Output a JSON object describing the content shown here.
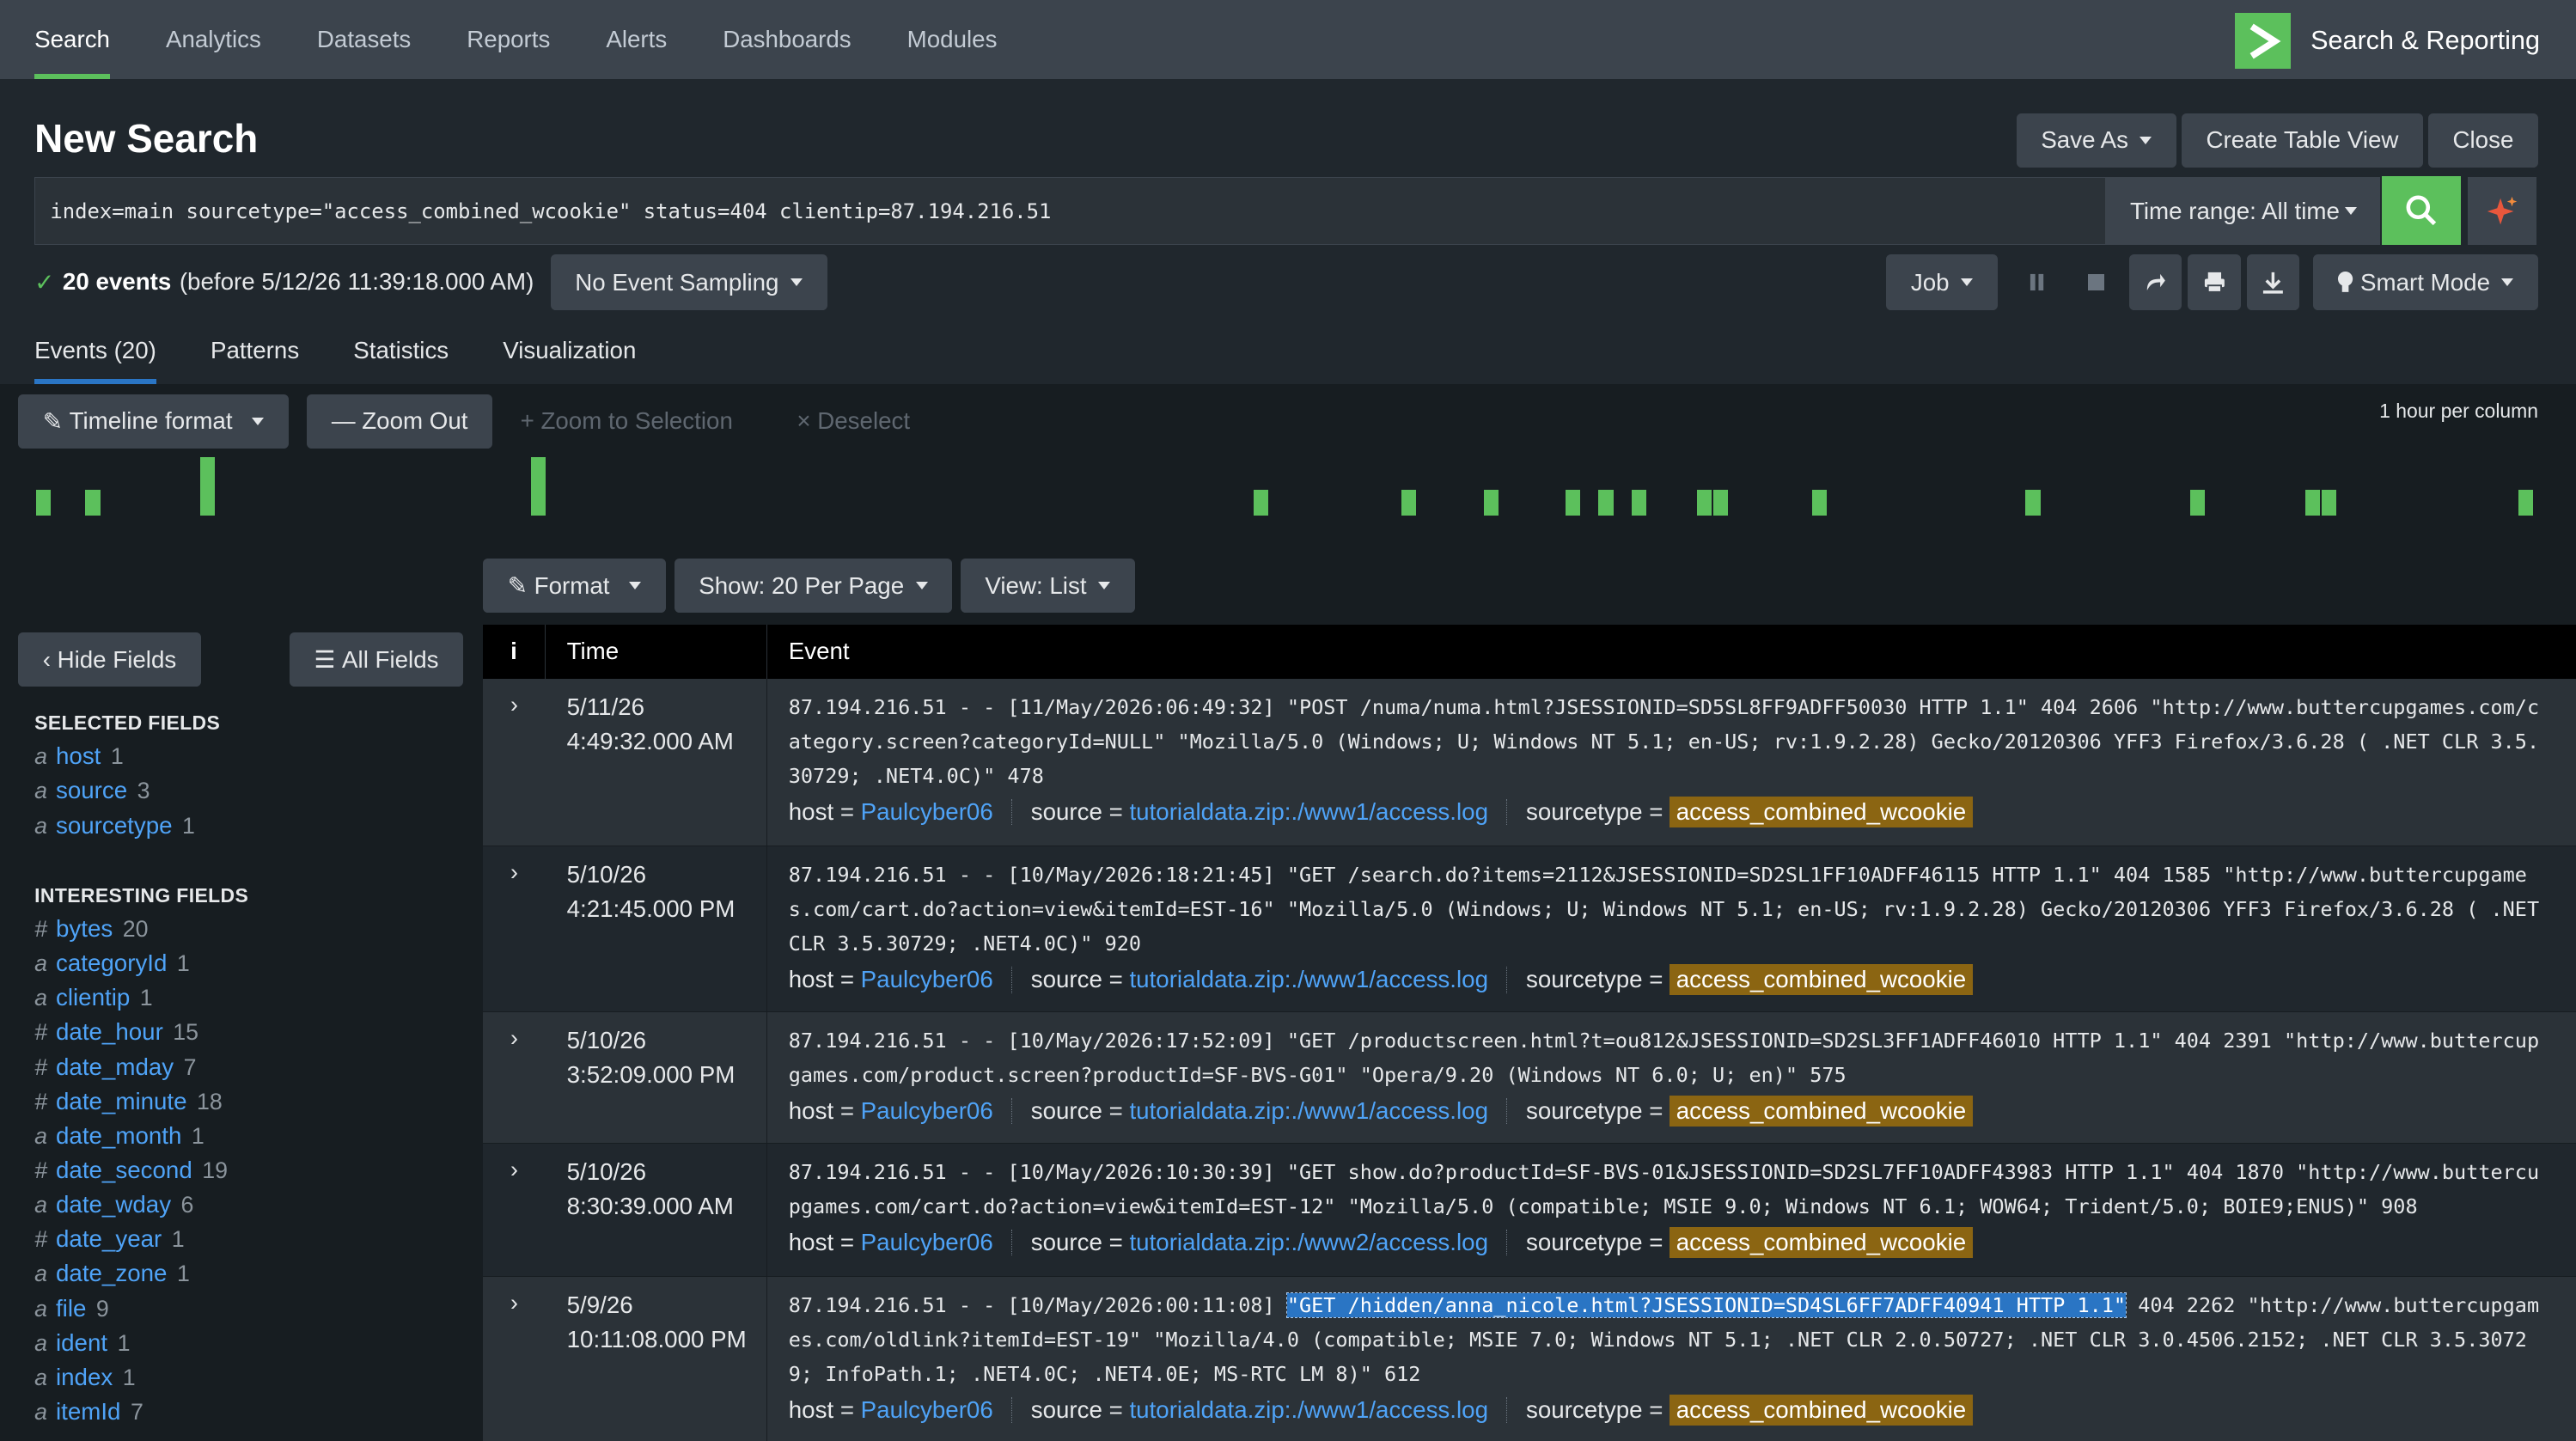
{
  "nav": {
    "tabs": [
      "Search",
      "Analytics",
      "Datasets",
      "Reports",
      "Alerts",
      "Dashboards",
      "Modules"
    ],
    "app_title": "Search & Reporting"
  },
  "page": {
    "title": "New Search",
    "save_as": "Save As",
    "create_table_view": "Create Table View",
    "close": "Close"
  },
  "search": {
    "query": "index=main sourcetype=\"access_combined_wcookie\" status=404 clientip=87.194.216.51",
    "time_range": "Time range: All time"
  },
  "status": {
    "count": "20 events",
    "detail": "(before 5/12/26 11:39:18.000 AM)",
    "sampling": "No Event Sampling",
    "job": "Job",
    "mode": "Smart Mode"
  },
  "tabs": [
    "Events (20)",
    "Patterns",
    "Statistics",
    "Visualization"
  ],
  "timeline": {
    "format": "Timeline format",
    "zoom_out": "Zoom Out",
    "zoom_selection": "Zoom to Selection",
    "deselect": "Deselect",
    "per_column": "1 hour per column",
    "bar_heights": [
      0.45,
      0.45,
      1.0,
      0,
      1.0,
      0.45,
      0.45,
      0.45,
      0.45,
      0.45,
      0.45,
      0.45,
      0.45,
      0.45,
      0.45,
      0.45,
      0.45,
      0.45
    ]
  },
  "list_controls": {
    "format": "Format",
    "show": "Show: 20 Per Page",
    "view": "View: List"
  },
  "sidebar": {
    "hide_fields": "Hide Fields",
    "all_fields": "All Fields",
    "selected_title": "SELECTED FIELDS",
    "selected": [
      {
        "type": "a",
        "name": "host",
        "count": "1"
      },
      {
        "type": "a",
        "name": "source",
        "count": "3"
      },
      {
        "type": "a",
        "name": "sourcetype",
        "count": "1"
      }
    ],
    "interesting_title": "INTERESTING FIELDS",
    "interesting": [
      {
        "type": "#",
        "name": "bytes",
        "count": "20"
      },
      {
        "type": "a",
        "name": "categoryId",
        "count": "1"
      },
      {
        "type": "a",
        "name": "clientip",
        "count": "1"
      },
      {
        "type": "#",
        "name": "date_hour",
        "count": "15"
      },
      {
        "type": "#",
        "name": "date_mday",
        "count": "7"
      },
      {
        "type": "#",
        "name": "date_minute",
        "count": "18"
      },
      {
        "type": "a",
        "name": "date_month",
        "count": "1"
      },
      {
        "type": "#",
        "name": "date_second",
        "count": "19"
      },
      {
        "type": "a",
        "name": "date_wday",
        "count": "6"
      },
      {
        "type": "#",
        "name": "date_year",
        "count": "1"
      },
      {
        "type": "a",
        "name": "date_zone",
        "count": "1"
      },
      {
        "type": "a",
        "name": "file",
        "count": "9"
      },
      {
        "type": "a",
        "name": "ident",
        "count": "1"
      },
      {
        "type": "a",
        "name": "index",
        "count": "1"
      },
      {
        "type": "a",
        "name": "itemId",
        "count": "7"
      }
    ]
  },
  "table": {
    "col_i": "i",
    "col_time": "Time",
    "col_event": "Event",
    "meta_labels": {
      "host": "host =",
      "source": "source =",
      "sourcetype": "sourcetype ="
    },
    "rows": [
      {
        "date": "5/11/26",
        "time": "4:49:32.000 AM",
        "raw": "87.194.216.51 - - [11/May/2026:06:49:32] \"POST /numa/numa.html?JSESSIONID=SD5SL8FF9ADFF50030 HTTP 1.1\" 404 2606 \"http://www.buttercupgames.com/category.screen?categoryId=NULL\" \"Mozilla/5.0 (Windows; U; Windows NT 5.1; en-US; rv:1.9.2.28) Gecko/20120306 YFF3 Firefox/3.6.28 ( .NET CLR 3.5.30729; .NET4.0C)\" 478",
        "host": "Paulcyber06",
        "source": "tutorialdata.zip:./www1/access.log",
        "sourcetype": "access_combined_wcookie"
      },
      {
        "date": "5/10/26",
        "time": "4:21:45.000 PM",
        "raw": "87.194.216.51 - - [10/May/2026:18:21:45] \"GET /search.do?items=2112&JSESSIONID=SD2SL1FF10ADFF46115 HTTP 1.1\" 404 1585 \"http://www.buttercupgames.com/cart.do?action=view&itemId=EST-16\" \"Mozilla/5.0 (Windows; U; Windows NT 5.1; en-US; rv:1.9.2.28) Gecko/20120306 YFF3 Firefox/3.6.28 ( .NET CLR 3.5.30729; .NET4.0C)\" 920",
        "host": "Paulcyber06",
        "source": "tutorialdata.zip:./www1/access.log",
        "sourcetype": "access_combined_wcookie"
      },
      {
        "date": "5/10/26",
        "time": "3:52:09.000 PM",
        "raw": "87.194.216.51 - - [10/May/2026:17:52:09] \"GET /productscreen.html?t=ou812&JSESSIONID=SD2SL3FF1ADFF46010 HTTP 1.1\" 404 2391 \"http://www.buttercupgames.com/product.screen?productId=SF-BVS-G01\" \"Opera/9.20 (Windows NT 6.0; U; en)\" 575",
        "host": "Paulcyber06",
        "source": "tutorialdata.zip:./www1/access.log",
        "sourcetype": "access_combined_wcookie"
      },
      {
        "date": "5/10/26",
        "time": "8:30:39.000 AM",
        "raw": "87.194.216.51 - - [10/May/2026:10:30:39] \"GET show.do?productId=SF-BVS-01&JSESSIONID=SD2SL7FF10ADFF43983 HTTP 1.1\" 404 1870 \"http://www.buttercupgames.com/cart.do?action=view&itemId=EST-12\" \"Mozilla/5.0 (compatible; MSIE 9.0; Windows NT 6.1; WOW64; Trident/5.0; BOIE9;ENUS)\" 908",
        "host": "Paulcyber06",
        "source": "tutorialdata.zip:./www2/access.log",
        "sourcetype": "access_combined_wcookie"
      },
      {
        "date": "5/9/26",
        "time": "10:11:08.000 PM",
        "raw_pre": "87.194.216.51 - - [10/May/2026:00:11:08] ",
        "raw_hl": "\"GET /hidden/anna_nicole.html?JSESSIONID=SD4SL6FF7ADFF40941 HTTP 1.1\"",
        "raw_post": " 404 2262 \"http://www.buttercupgames.com/oldlink?itemId=EST-19\" \"Mozilla/4.0 (compatible; MSIE 7.0; Windows NT 5.1; .NET CLR 2.0.50727; .NET CLR 3.0.4506.2152; .NET CLR 3.5.30729; InfoPath.1; .NET4.0C; .NET4.0E; MS-RTC LM 8)\" 612",
        "host": "Paulcyber06",
        "source": "tutorialdata.zip:./www1/access.log",
        "sourcetype": "access_combined_wcookie"
      }
    ]
  }
}
